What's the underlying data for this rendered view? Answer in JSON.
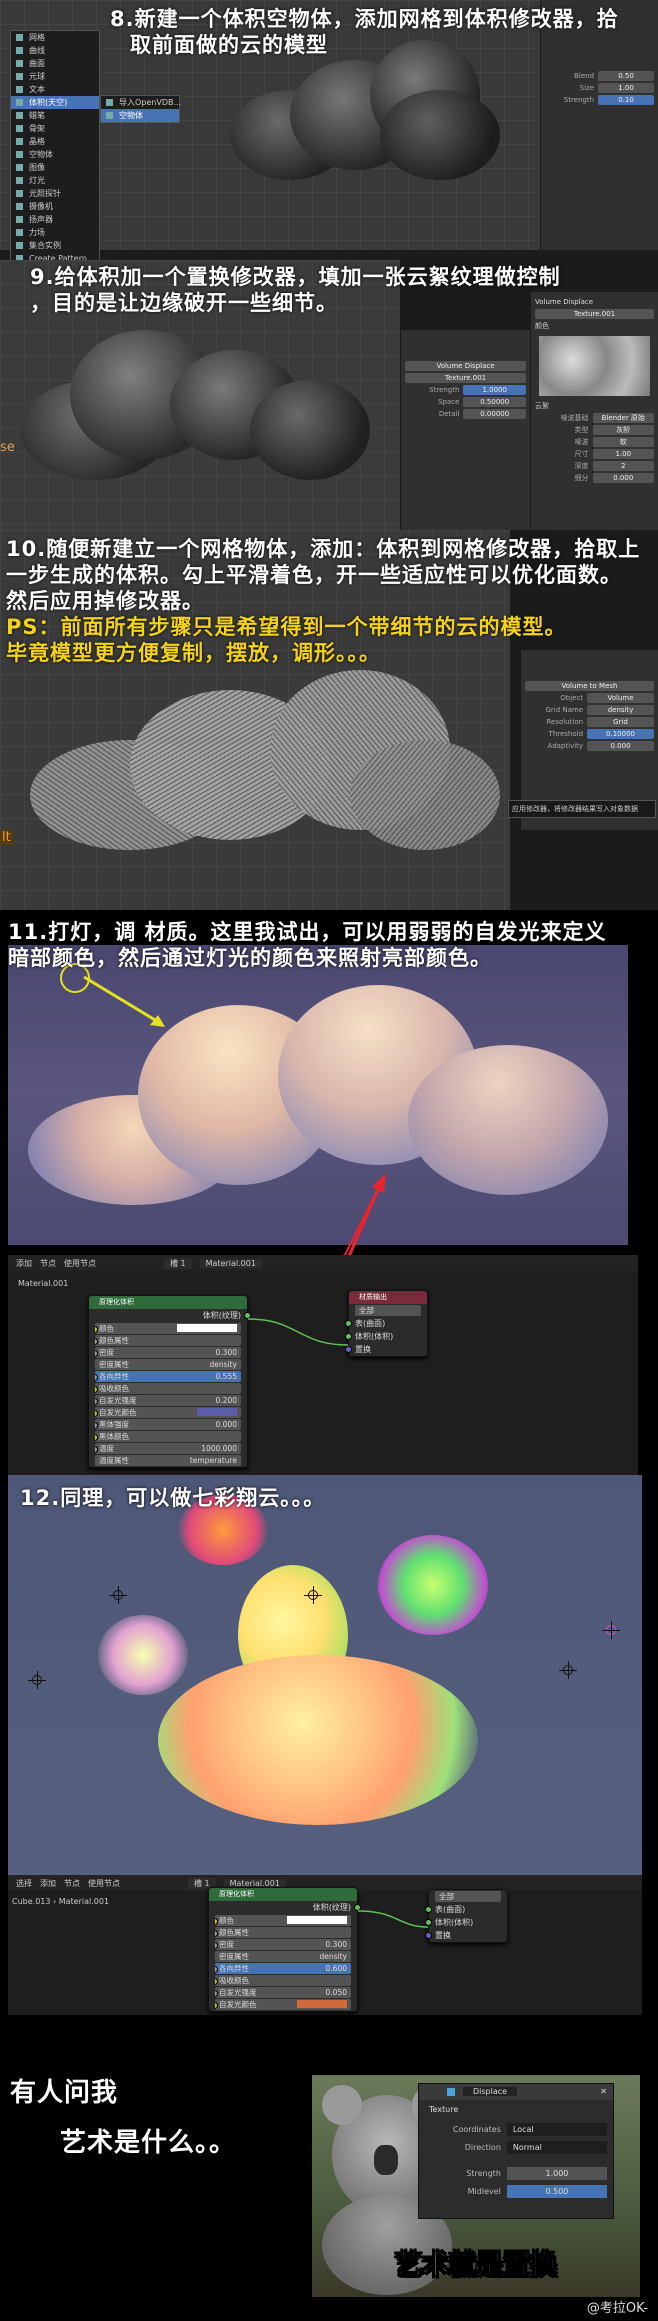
{
  "step8": {
    "caption_line1": "8.新建一个体积空物体，添加网格到体积修改器，拾",
    "caption_line2": "取前面做的云的模型",
    "menu_items": [
      "网格",
      "曲线",
      "曲面",
      "元球",
      "文本",
      "体积(天空)",
      "蜡笔",
      "骨架",
      "晶格",
      "空物体",
      "图像",
      "灯光",
      "光照探针",
      "摄像机",
      "扬声器",
      "力场",
      "集合实例",
      "Create Pattern"
    ],
    "submenu_items": [
      "导入OpenVDB...",
      "空物体"
    ],
    "prop_rows": [
      [
        "Blend",
        "0.50"
      ],
      [
        "Size",
        "1.00"
      ],
      [
        "Strength",
        "0.10"
      ]
    ]
  },
  "step9": {
    "caption_line1": "9.给体积加一个置换修改器，填加一张云絮纹理做控制",
    "caption_line2": "，目的是让边缘破开一些细节。",
    "modifier_name": "Volume Displace",
    "texture_name": "Texture.001",
    "mod_rows": [
      [
        "Strength",
        "1.0000"
      ],
      [
        "Space",
        "0.50000"
      ],
      [
        "Detail",
        "0.00000"
      ]
    ],
    "tex_panel_title": "Volume Displace",
    "tex_sections": [
      "颜色",
      "云絮"
    ],
    "tex_rows": [
      [
        "噪波基础",
        "Blender 原始"
      ],
      [
        "类型",
        "灰阶"
      ],
      [
        "噪波",
        "软"
      ],
      [
        "尺寸",
        "1.00"
      ],
      [
        "深度",
        "2"
      ],
      [
        "细分",
        "0.000"
      ]
    ],
    "margin_text": "se"
  },
  "step10": {
    "caption_line1": "10.随便新建立一个网格物体，添加：体积到网格修改器，拾取上",
    "caption_line2": "一步生成的体积。勾上平滑着色，开一些适应性可以优化面数。",
    "caption_line3": "然后应用掉修改器。",
    "ps_line1": "PS：前面所有步骤只是希望得到一个带细节的云的模型。",
    "ps_line2": "毕竟模型更方便复制，摆放，调形。。。",
    "modifier_name": "Volume to Mesh",
    "rows": [
      [
        "Object",
        "Volume"
      ],
      [
        "Grid Name",
        "density"
      ],
      [
        "Resolution",
        "Grid"
      ],
      [
        "Threshold",
        "0.10000"
      ],
      [
        "Adaptivity",
        "0.000"
      ]
    ],
    "tooltip": "应用修改器，将修改器结果写入对象数据",
    "margin_text": "lt"
  },
  "step11": {
    "caption_line1": "11.打灯，调 材质。这里我试出，可以用弱弱的自发光来定义",
    "caption_line2": "暗部颜色，然后通过灯光的颜色来照射亮部颜色。",
    "header_items": [
      "添加",
      "节点",
      "使用节点"
    ],
    "slot": "槽 1",
    "material": "Material.001",
    "object_label": "Material.001",
    "node_title": "原理化体积",
    "node_output": "体积(纹理)",
    "node_rows": [
      [
        "颜色",
        ""
      ],
      [
        "颜色属性",
        ""
      ],
      [
        "密度",
        "0.300"
      ],
      [
        "密度属性",
        "density"
      ],
      [
        "各向异性",
        "0.555"
      ],
      [
        "吸收颜色",
        ""
      ],
      [
        "自发光强度",
        "0.200"
      ],
      [
        "自发光颜色",
        ""
      ],
      [
        "黑体强度",
        "0.000"
      ],
      [
        "黑体颜色",
        ""
      ],
      [
        "温度",
        "1000.000"
      ],
      [
        "温度属性",
        "temperature"
      ]
    ],
    "output_title": "材质输出",
    "output_target": "全部",
    "output_rows": [
      "表(曲面)",
      "体积(体积)",
      "置换"
    ]
  },
  "step12": {
    "caption": "12.同理，可以做七彩翔云。。。",
    "header_items": [
      "选择",
      "添加",
      "节点",
      "使用节点"
    ],
    "object_name": "Cube.013",
    "slot": "槽 1",
    "material": "Material.001",
    "node_title": "原理化体积",
    "node_output": "体积(纹理)",
    "node_rows": [
      [
        "颜色",
        ""
      ],
      [
        "颜色属性",
        ""
      ],
      [
        "密度",
        "0.300"
      ],
      [
        "密度属性",
        "density"
      ],
      [
        "各向异性",
        "0.600"
      ],
      [
        "吸收颜色",
        ""
      ],
      [
        "自发光强度",
        "0.050"
      ],
      [
        "自发光颜色",
        ""
      ]
    ],
    "output_target": "全部",
    "output_rows": [
      "表(曲面)",
      "体积(体积)",
      "置换"
    ]
  },
  "meme": {
    "line1": "有人问我",
    "line2": "艺术是什么。。",
    "panel_title": "Displace",
    "texture_label": "Texture",
    "rows": [
      [
        "Coordinates",
        "Local"
      ],
      [
        "Direction",
        "Normal"
      ],
      [
        "Strength",
        "1.000"
      ],
      [
        "Midlevel",
        "0.500"
      ]
    ],
    "bottom_text": "艺术就是置换",
    "watermark": "@考拉OK-"
  },
  "colors": {
    "accent": "#4772b3",
    "yellow": "#f4d21a",
    "arrow_red": "#e8242e"
  }
}
